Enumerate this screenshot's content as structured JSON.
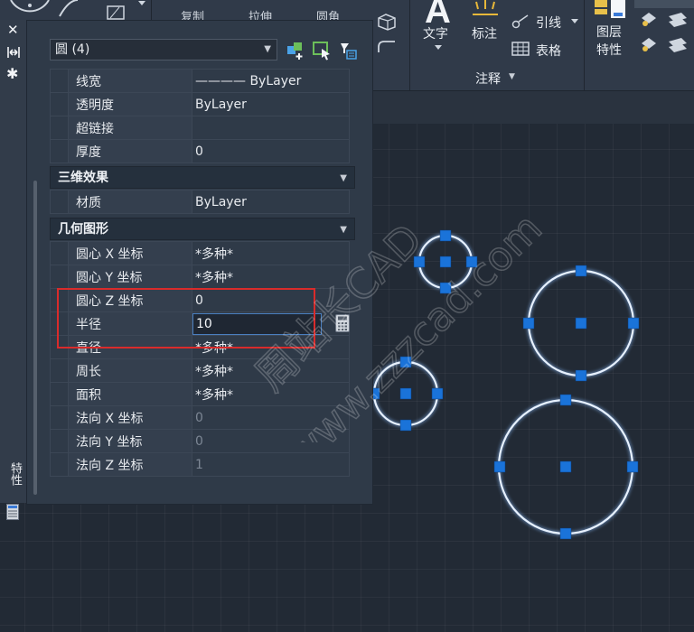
{
  "ribbon": {
    "text_label": "文字",
    "dim_label": "标注",
    "leader_label": "引线",
    "table_label": "表格",
    "layer_props_label": "图层\n特性",
    "annotation_panel": "注释",
    "annotation_caret": "▼",
    "truncated_left": "复制",
    "truncated_mid": "拉伸",
    "truncated_right": "圆角"
  },
  "palette": {
    "title_vertical": "特性",
    "object_selector": "圆 (4)",
    "rows_general": [
      {
        "key": "线宽",
        "value": "———— ByLayer"
      },
      {
        "key": "透明度",
        "value": "ByLayer"
      },
      {
        "key": "超链接",
        "value": ""
      },
      {
        "key": "厚度",
        "value": "0"
      }
    ],
    "section_3d": "三维效果",
    "rows_3d": [
      {
        "key": "材质",
        "value": "ByLayer"
      }
    ],
    "section_geometry": "几何图形",
    "rows_geometry": [
      {
        "key": "圆心 X 坐标",
        "value": "*多种*"
      },
      {
        "key": "圆心 Y 坐标",
        "value": "*多种*"
      },
      {
        "key": "圆心 Z 坐标",
        "value": "0"
      },
      {
        "key": "半径",
        "value": "10"
      },
      {
        "key": "直径",
        "value": "*多种*"
      },
      {
        "key": "周长",
        "value": "*多种*"
      },
      {
        "key": "面积",
        "value": "*多种*"
      },
      {
        "key": "法向 X 坐标",
        "value": "0"
      },
      {
        "key": "法向 Y 坐标",
        "value": "0"
      },
      {
        "key": "法向 Z 坐标",
        "value": "1"
      }
    ]
  },
  "watermark": {
    "line1": "周站长CAD",
    "line2": "www.zzzcad.com"
  },
  "colors": {
    "canvas": "#222a35",
    "grips": "#1a73d9",
    "circle": "#e7f1ff",
    "highlight": "#d92b2b"
  }
}
